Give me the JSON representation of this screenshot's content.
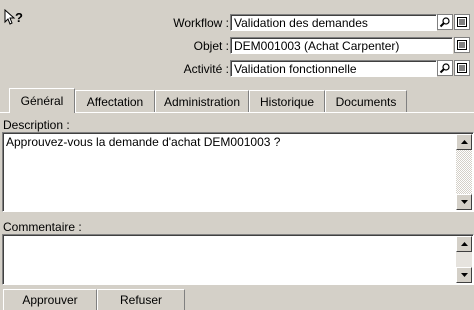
{
  "icons": {
    "help": "help-cursor-icon",
    "search": "magnifier-icon",
    "detail": "detail-form-icon",
    "scroll_up": "scroll-up-arrow-icon",
    "scroll_down": "scroll-down-arrow-icon"
  },
  "fields": {
    "workflow": {
      "label": "Workflow :",
      "value": "Validation des demandes"
    },
    "objet": {
      "label": "Objet :",
      "value": "DEM001003 (Achat Carpenter)"
    },
    "activite": {
      "label": "Activité :",
      "value": "Validation fonctionnelle"
    }
  },
  "tabs": [
    {
      "label": "Général",
      "active": true
    },
    {
      "label": "Affectation",
      "active": false
    },
    {
      "label": "Administration",
      "active": false
    },
    {
      "label": "Historique",
      "active": false
    },
    {
      "label": "Documents",
      "active": false
    }
  ],
  "description": {
    "label": "Description :",
    "text": "Approuvez-vous la demande d'achat DEM001003 ?"
  },
  "commentaire": {
    "label": "Commentaire :",
    "text": ""
  },
  "actions": {
    "approve": "Approuver",
    "refuse": "Refuser"
  }
}
